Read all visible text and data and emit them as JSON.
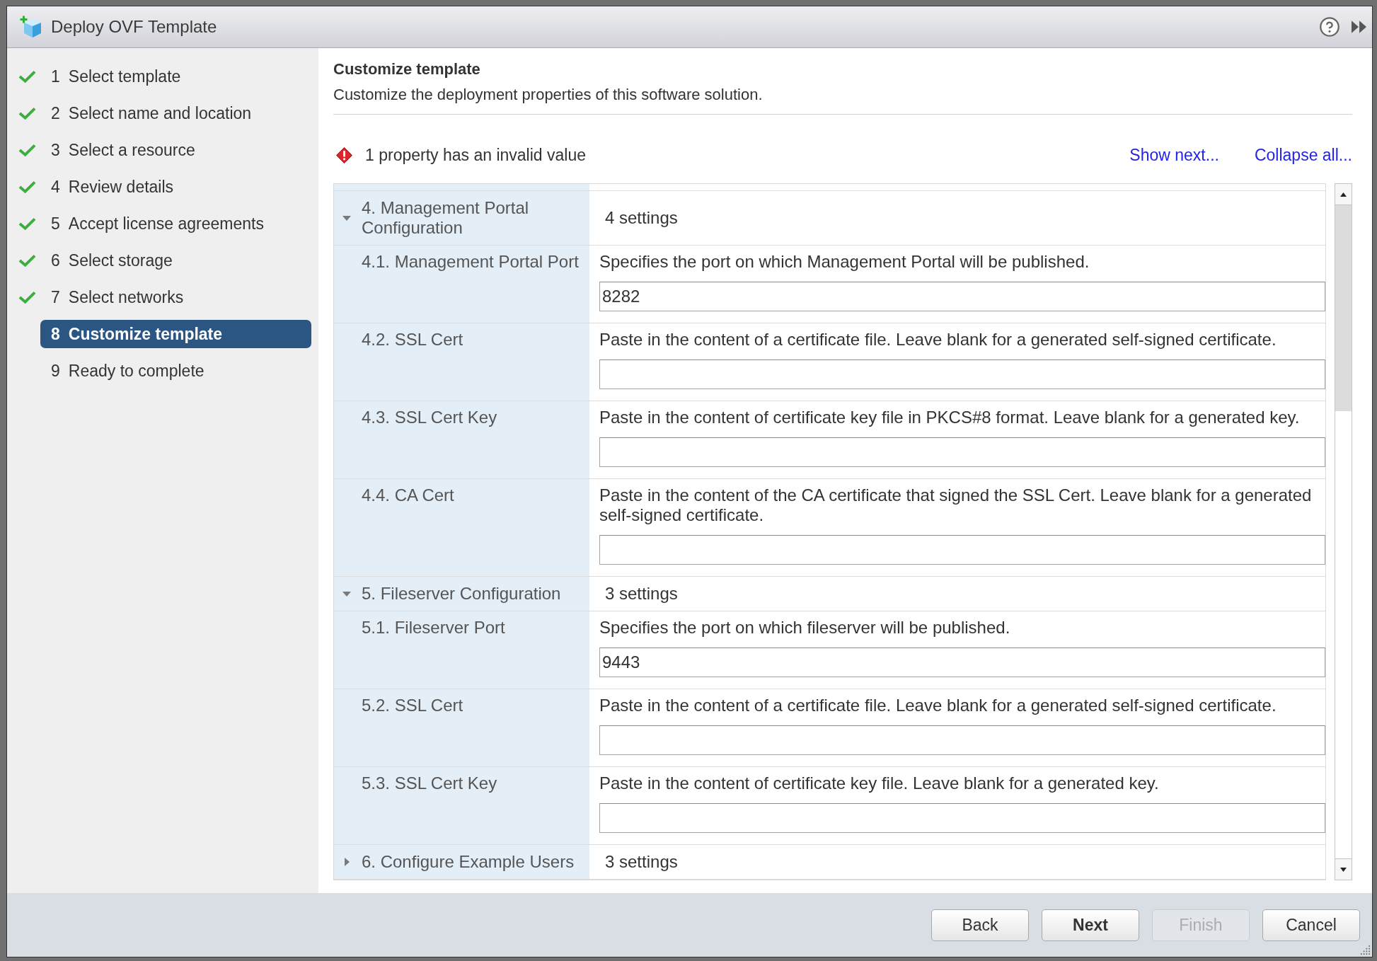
{
  "window": {
    "title": "Deploy OVF Template"
  },
  "steps": [
    {
      "number": "1",
      "label": "Select template",
      "completed": true,
      "selected": false
    },
    {
      "number": "2",
      "label": "Select name and location",
      "completed": true,
      "selected": false
    },
    {
      "number": "3",
      "label": "Select a resource",
      "completed": true,
      "selected": false
    },
    {
      "number": "4",
      "label": "Review details",
      "completed": true,
      "selected": false
    },
    {
      "number": "5",
      "label": "Accept license agreements",
      "completed": true,
      "selected": false
    },
    {
      "number": "6",
      "label": "Select storage",
      "completed": true,
      "selected": false
    },
    {
      "number": "7",
      "label": "Select networks",
      "completed": true,
      "selected": false
    },
    {
      "number": "8",
      "label": "Customize template",
      "completed": false,
      "selected": true
    },
    {
      "number": "9",
      "label": "Ready to complete",
      "completed": false,
      "selected": false
    }
  ],
  "page": {
    "title": "Customize template",
    "subtitle": "Customize the deployment properties of this software solution."
  },
  "validation": {
    "message": "1 property has an invalid value"
  },
  "links": [
    "Show next...",
    "Collapse all..."
  ],
  "property_groups": [
    {
      "label": "4. Management Portal Configuration",
      "summary": "4 settings",
      "expanded": true,
      "children": [
        {
          "label": "4.1. Management Portal Port",
          "description": "Specifies the port on which Management Portal will be published.",
          "value": "8282"
        },
        {
          "label": "4.2. SSL Cert",
          "description": "Paste in the content of a certificate file. Leave blank for a generated self-signed certificate."
        },
        {
          "label": "4.3. SSL Cert Key",
          "description": "Paste in the content of certificate key file in PKCS#8 format. Leave blank for a generated key."
        },
        {
          "label": "4.4. CA Cert",
          "description": "Paste in the content of the CA certificate that signed the SSL Cert. Leave blank for a generated self-signed certificate."
        }
      ]
    },
    {
      "label": "5. Fileserver Configuration",
      "summary": "3 settings",
      "expanded": true,
      "children": [
        {
          "label": "5.1. Fileserver Port",
          "description": "Specifies the port on which fileserver will be published.",
          "value": "9443"
        },
        {
          "label": "5.2. SSL Cert",
          "description": "Paste in the content of a certificate file. Leave blank for a generated self-signed certificate."
        },
        {
          "label": "5.3. SSL Cert Key",
          "description": "Paste in the content of certificate key file. Leave blank for a generated key."
        }
      ]
    },
    {
      "label": "6. Configure Example Users",
      "summary": "3 settings",
      "expanded": false
    }
  ],
  "buttons": [
    {
      "label": "Back",
      "primary": false,
      "disabled": false
    },
    {
      "label": "Next",
      "primary": true,
      "disabled": false
    },
    {
      "label": "Finish",
      "primary": false,
      "disabled": true
    },
    {
      "label": "Cancel",
      "primary": false,
      "disabled": false
    }
  ]
}
